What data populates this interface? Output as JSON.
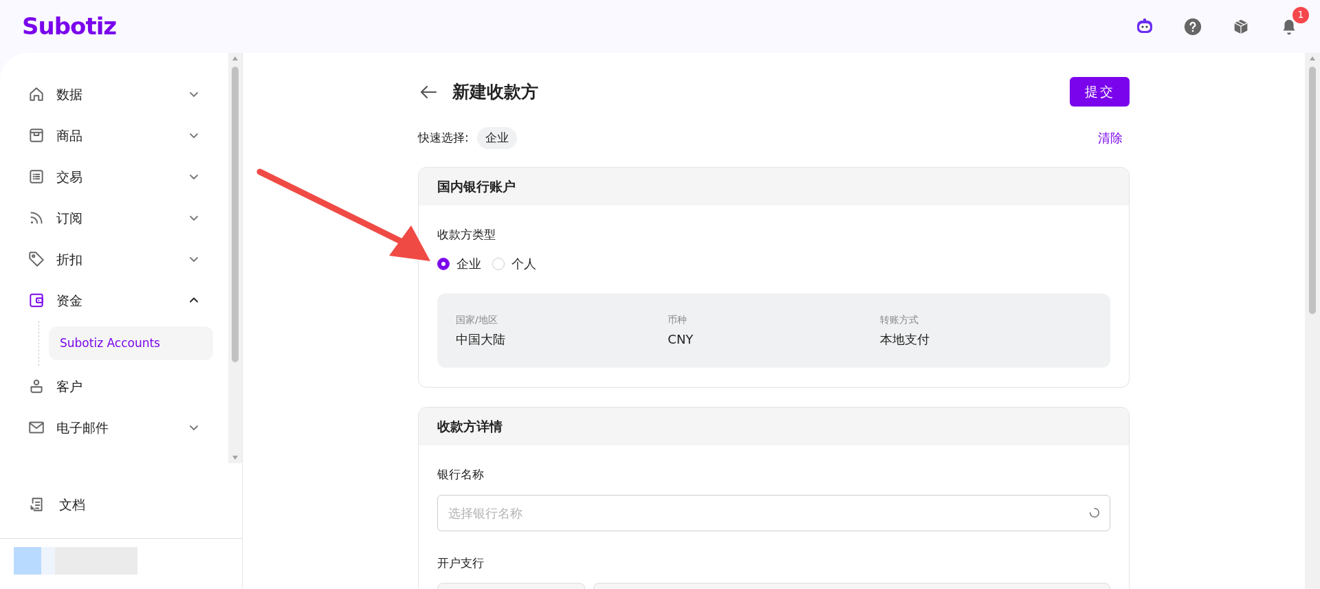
{
  "header": {
    "logo": "Subotiz",
    "notification_count": "1"
  },
  "sidebar": {
    "items": [
      {
        "label": "数据",
        "kind": "group",
        "expanded": false
      },
      {
        "label": "商品",
        "kind": "group",
        "expanded": false
      },
      {
        "label": "交易",
        "kind": "group",
        "expanded": false
      },
      {
        "label": "订阅",
        "kind": "group",
        "expanded": false
      },
      {
        "label": "折扣",
        "kind": "group",
        "expanded": false
      },
      {
        "label": "资金",
        "kind": "group",
        "expanded": true,
        "children": [
          {
            "label": "Subotiz Accounts",
            "selected": true
          }
        ]
      },
      {
        "label": "客户",
        "kind": "link"
      },
      {
        "label": "电子邮件",
        "kind": "group",
        "expanded": false
      }
    ],
    "footer_item": "文档"
  },
  "page": {
    "title": "新建收款方",
    "submit": "提交",
    "quick_select": {
      "label": "快速选择:",
      "chips": [
        "企业"
      ],
      "clear": "清除"
    },
    "sections": [
      {
        "title": "国内银行账户",
        "fields": [
          {
            "kind": "radio",
            "label": "收款方类型",
            "options": [
              {
                "label": "企业",
                "selected": true
              },
              {
                "label": "个人",
                "selected": false
              }
            ]
          },
          {
            "kind": "info",
            "items": [
              {
                "label": "国家/地区",
                "value": "中国大陆"
              },
              {
                "label": "币种",
                "value": "CNY"
              },
              {
                "label": "转账方式",
                "value": "本地支付"
              }
            ]
          }
        ]
      },
      {
        "title": "收款方详情",
        "fields": [
          {
            "kind": "select",
            "label": "银行名称",
            "placeholder": "选择银行名称",
            "loading": true
          },
          {
            "kind": "split",
            "label": "开户支行"
          }
        ]
      }
    ]
  }
}
